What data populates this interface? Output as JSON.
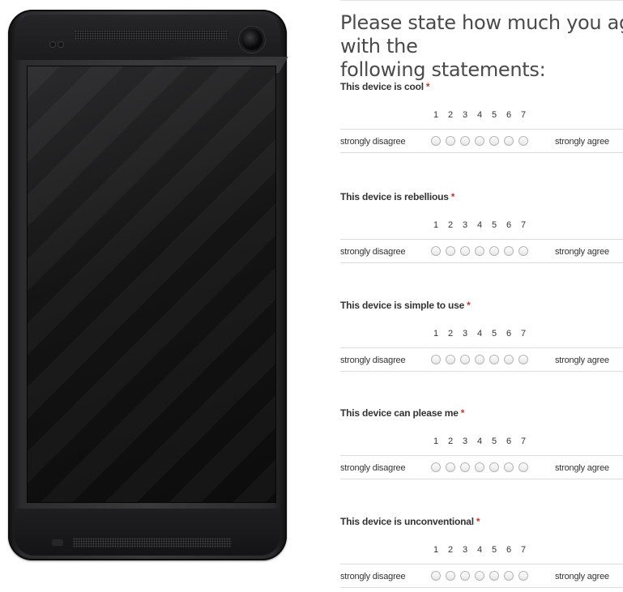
{
  "survey": {
    "heading": "Please state how much you agree with the\nfollowing statements:",
    "scale": [
      "1",
      "2",
      "3",
      "4",
      "5",
      "6",
      "7"
    ],
    "left_anchor": "strongly disagree",
    "right_anchor": "strongly agree",
    "required_mark": "*",
    "required_color": "#c0392b",
    "questions": [
      {
        "label": "This device is cool"
      },
      {
        "label": "This device is rebellious"
      },
      {
        "label": "This device is simple to use"
      },
      {
        "label": "This device can please me"
      },
      {
        "label": "This device is unconventional"
      }
    ]
  },
  "phone": {
    "icon": "smartphone-mockup",
    "frame_color": "#2f2f31",
    "screen_color": "#111111"
  }
}
